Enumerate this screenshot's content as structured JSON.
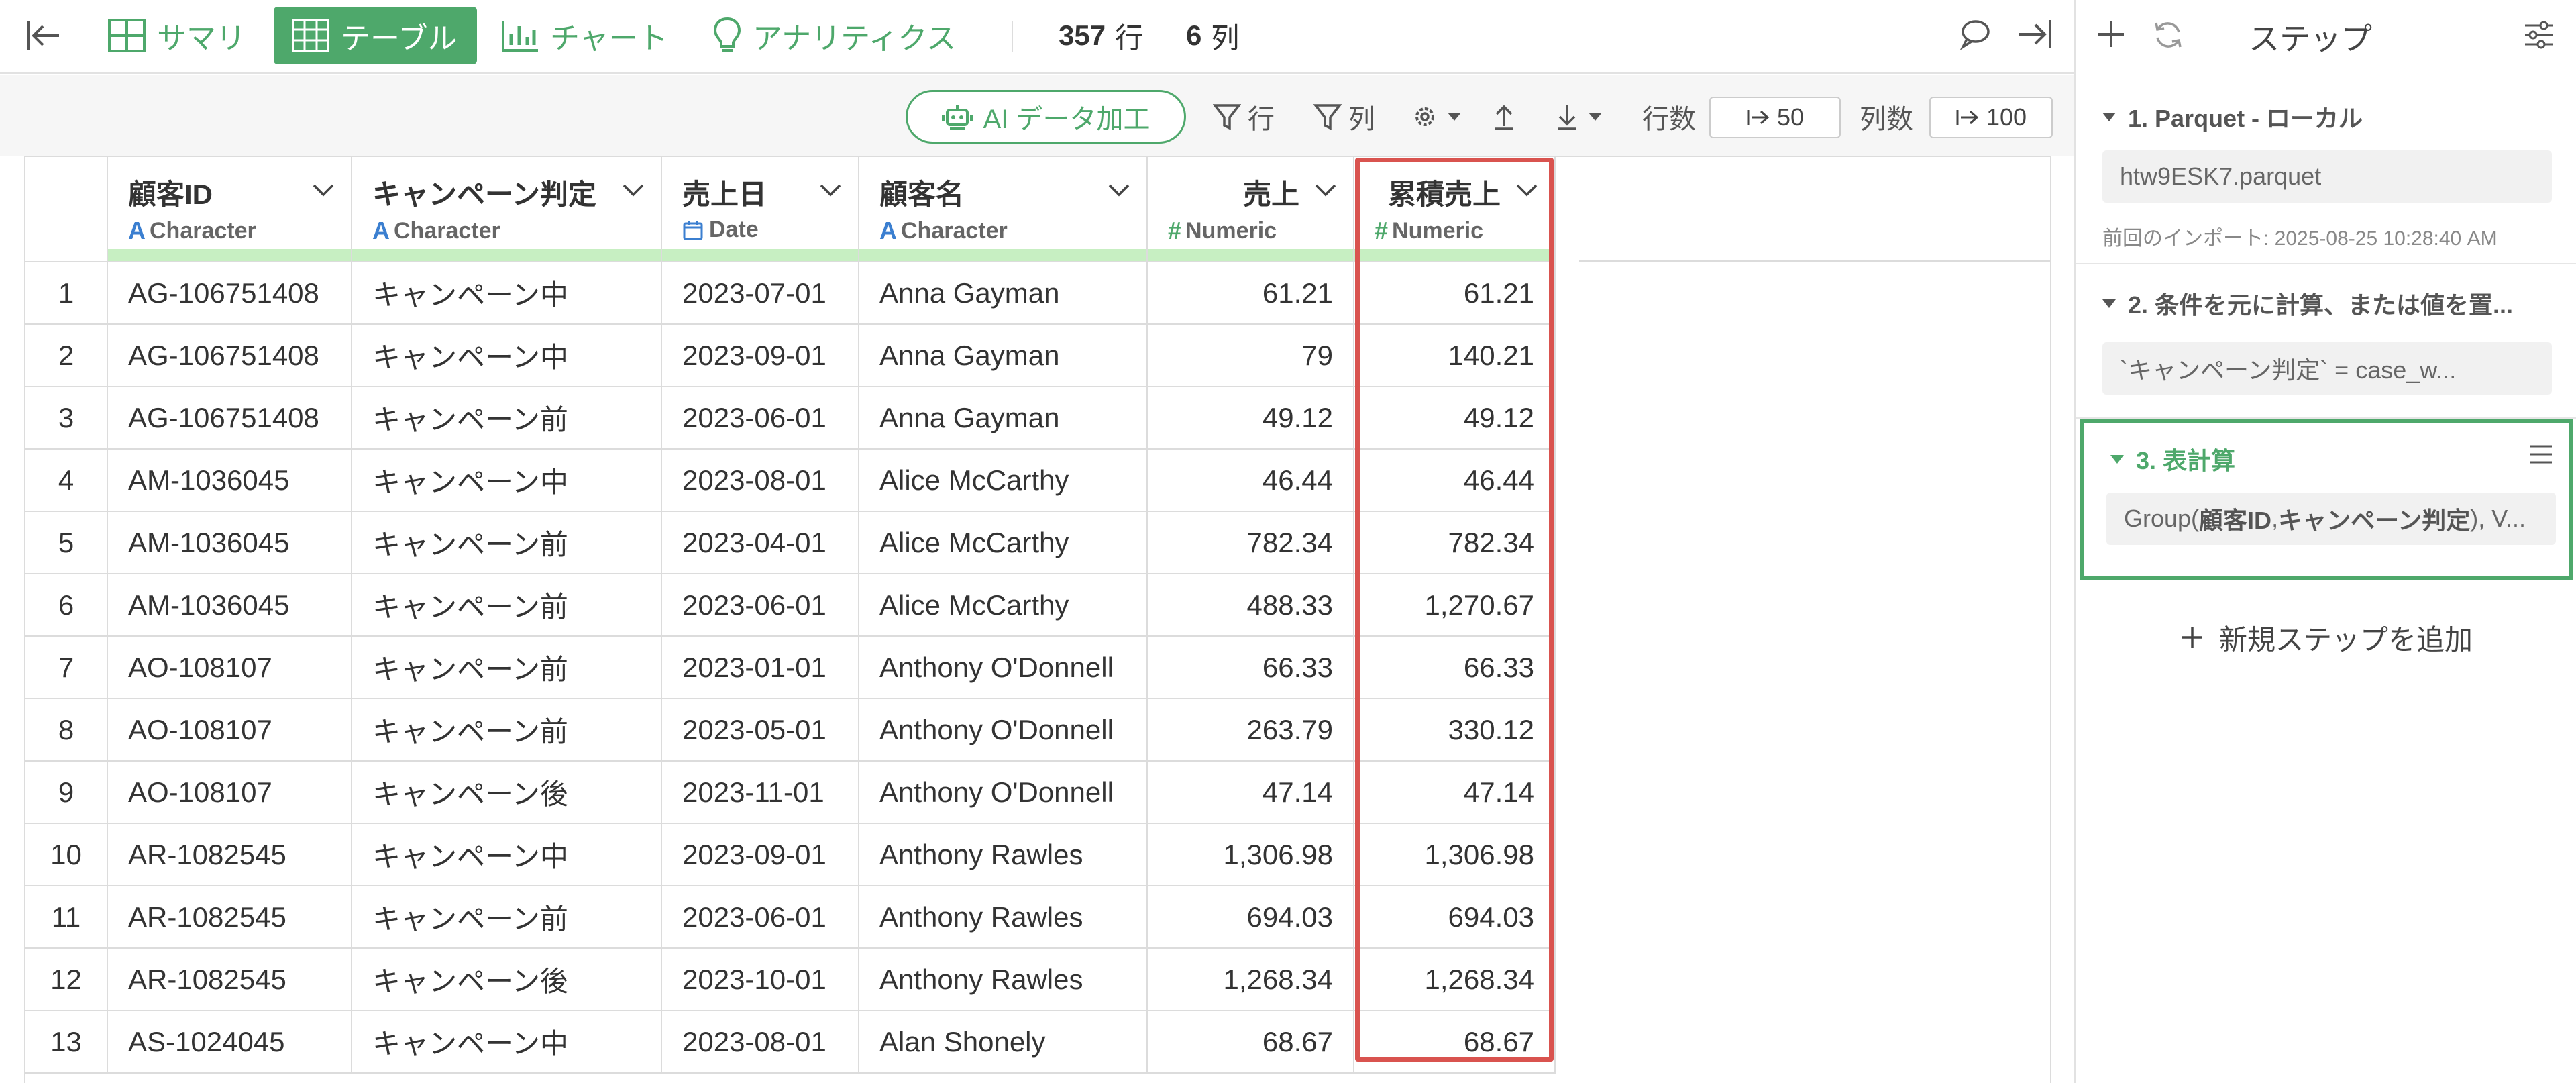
{
  "topbar": {
    "tabs": [
      {
        "label": "サマリ"
      },
      {
        "label": "テーブル"
      },
      {
        "label": "チャート"
      },
      {
        "label": "アナリティクス"
      }
    ],
    "row_count": "357",
    "row_unit": "行",
    "col_count": "6",
    "col_unit": "列"
  },
  "toolbar": {
    "ai_label": "AI データ加工",
    "filter_row_label": "行",
    "filter_col_label": "列",
    "rows_label": "行数",
    "rows_value": "50",
    "cols_label": "列数",
    "cols_value": "100"
  },
  "table": {
    "columns": [
      {
        "name": "顧客ID",
        "type": "Character",
        "type_icon": "A"
      },
      {
        "name": "キャンペーン判定",
        "type": "Character",
        "type_icon": "A"
      },
      {
        "name": "売上日",
        "type": "Date",
        "type_icon": "calendar"
      },
      {
        "name": "顧客名",
        "type": "Character",
        "type_icon": "A"
      },
      {
        "name": "売上",
        "type": "Numeric",
        "type_icon": "#"
      },
      {
        "name": "累積売上",
        "type": "Numeric",
        "type_icon": "#"
      }
    ],
    "rows": [
      [
        "1",
        "AG-106751408",
        "キャンペーン中",
        "2023-07-01",
        "Anna Gayman",
        "61.21",
        "61.21"
      ],
      [
        "2",
        "AG-106751408",
        "キャンペーン中",
        "2023-09-01",
        "Anna Gayman",
        "79",
        "140.21"
      ],
      [
        "3",
        "AG-106751408",
        "キャンペーン前",
        "2023-06-01",
        "Anna Gayman",
        "49.12",
        "49.12"
      ],
      [
        "4",
        "AM-1036045",
        "キャンペーン中",
        "2023-08-01",
        "Alice McCarthy",
        "46.44",
        "46.44"
      ],
      [
        "5",
        "AM-1036045",
        "キャンペーン前",
        "2023-04-01",
        "Alice McCarthy",
        "782.34",
        "782.34"
      ],
      [
        "6",
        "AM-1036045",
        "キャンペーン前",
        "2023-06-01",
        "Alice McCarthy",
        "488.33",
        "1,270.67"
      ],
      [
        "7",
        "AO-108107",
        "キャンペーン前",
        "2023-01-01",
        "Anthony O'Donnell",
        "66.33",
        "66.33"
      ],
      [
        "8",
        "AO-108107",
        "キャンペーン前",
        "2023-05-01",
        "Anthony O'Donnell",
        "263.79",
        "330.12"
      ],
      [
        "9",
        "AO-108107",
        "キャンペーン後",
        "2023-11-01",
        "Anthony O'Donnell",
        "47.14",
        "47.14"
      ],
      [
        "10",
        "AR-1082545",
        "キャンペーン中",
        "2023-09-01",
        "Anthony Rawles",
        "1,306.98",
        "1,306.98"
      ],
      [
        "11",
        "AR-1082545",
        "キャンペーン前",
        "2023-06-01",
        "Anthony Rawles",
        "694.03",
        "694.03"
      ],
      [
        "12",
        "AR-1082545",
        "キャンペーン後",
        "2023-10-01",
        "Anthony Rawles",
        "1,268.34",
        "1,268.34"
      ],
      [
        "13",
        "AS-1024045",
        "キャンペーン中",
        "2023-08-01",
        "Alan Shonely",
        "68.67",
        "68.67"
      ]
    ]
  },
  "panel": {
    "title": "ステップ",
    "steps": [
      {
        "title": "1. Parquet - ローカル",
        "body": "htw9ESK7.parquet",
        "meta": "前回のインポート: 2025-08-25 10:28:40 AM"
      },
      {
        "title": "2. 条件を元に計算、または値を置...",
        "body": "`キャンペーン判定` = case_w..."
      },
      {
        "title": "3. 表計算",
        "body_prefix": "Group(",
        "body_bold1": "顧客ID",
        "body_sep": ", ",
        "body_bold2": "キャンペーン判定",
        "body_suffix": "), V..."
      }
    ],
    "add_step_label": "新規ステップを追加"
  },
  "colors": {
    "accent": "#4ea86b",
    "highlight": "#d9534f",
    "header_bar": "#c7efc2"
  }
}
